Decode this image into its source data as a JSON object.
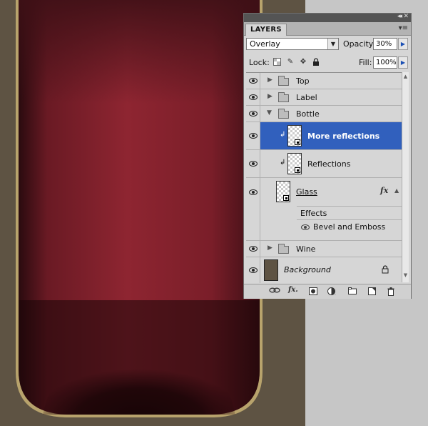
{
  "panel": {
    "tab": "LAYERS",
    "collapse_glyph": "◂◂",
    "close_glyph": "✕",
    "menu_glyph": "▾≡",
    "blend_mode": "Overlay",
    "opacity_label": "Opacity:",
    "opacity_value": "30%",
    "lock_label": "Lock:",
    "fill_label": "Fill:",
    "fill_value": "100%"
  },
  "layers": {
    "top": "Top",
    "label": "Label",
    "bottle": "Bottle",
    "more_reflections": "More reflections",
    "reflections": "Reflections",
    "glass": "Glass",
    "effects": "Effects",
    "bevel": "Bevel and Emboss",
    "wine": "Wine",
    "background": "Background"
  },
  "colors": {
    "wine": "#8a2330",
    "selection": "#3160bd",
    "background_swatch": "#5e5343"
  },
  "icons": [
    "eye-icon",
    "folder-icon",
    "chain-icon",
    "fx-icon",
    "lock-icon",
    "mask-icon",
    "adjustment-icon",
    "new-layer-icon",
    "trash-icon"
  ]
}
